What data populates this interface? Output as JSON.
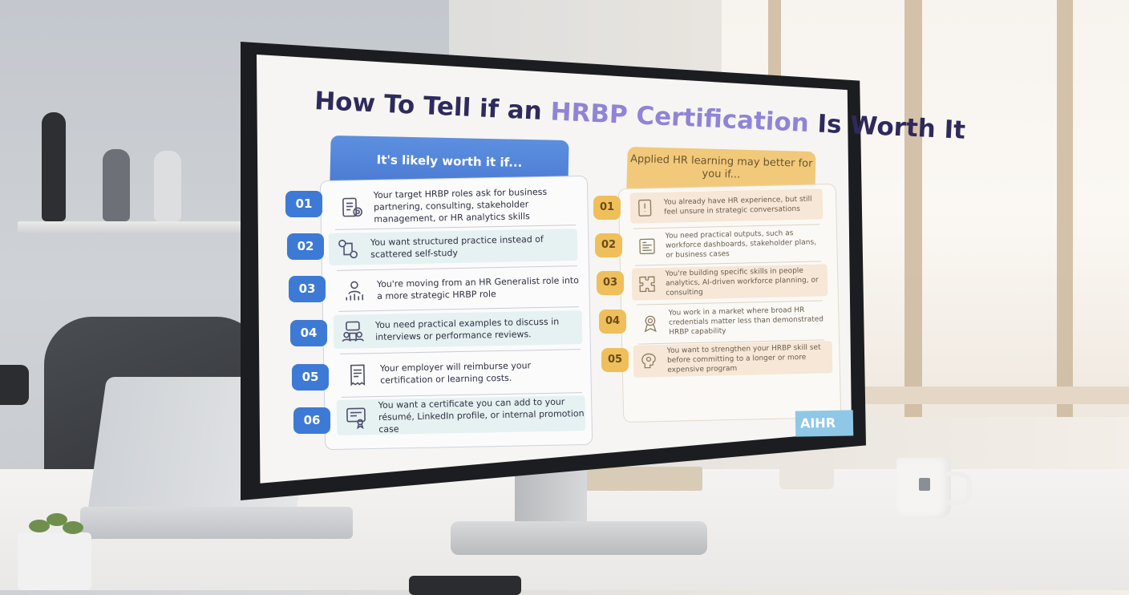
{
  "slide": {
    "title_pre": "How To Tell if an ",
    "title_highlight": "HRBP Certification",
    "title_post": " Is Worth It",
    "left_header": "It's likely worth it if...",
    "right_header": "Applied HR learning may better for you if...",
    "left_items": [
      {
        "num": "01",
        "icon": "clipboard-target-icon",
        "text": "Your target HRBP roles ask for business partnering, consulting, stakeholder management, or HR analytics skills"
      },
      {
        "num": "02",
        "icon": "connected-people-icon",
        "text": "You want structured practice instead of scattered self-study"
      },
      {
        "num": "03",
        "icon": "career-growth-icon",
        "text": "You're moving from an HR Generalist role into a more strategic HRBP role"
      },
      {
        "num": "04",
        "icon": "discussion-icon",
        "text": "You need practical examples to discuss in interviews or performance reviews."
      },
      {
        "num": "05",
        "icon": "receipt-icon",
        "text": "Your employer will reimburse your certification or learning costs."
      },
      {
        "num": "06",
        "icon": "certificate-icon",
        "text": "You want a certificate you can add to your résumé, LinkedIn profile, or internal promotion case"
      }
    ],
    "right_items": [
      {
        "num": "01",
        "icon": "document-alert-icon",
        "text": "You already have HR experience, but still feel unsure in strategic conversations"
      },
      {
        "num": "02",
        "icon": "dashboard-icon",
        "text": "You need practical outputs, such as workforce dashboards, stakeholder plans, or business cases"
      },
      {
        "num": "03",
        "icon": "puzzle-icon",
        "text": "You're building specific skills in people analytics, AI-driven workforce planning, or consulting"
      },
      {
        "num": "04",
        "icon": "award-ribbon-icon",
        "text": "You work in a market where broad HR credentials matter less than demonstrated HRBP capability"
      },
      {
        "num": "05",
        "icon": "brain-gear-icon",
        "text": "You want to strengthen your HRBP skill set before committing to a longer or more expensive program"
      }
    ],
    "brand": "AIHR"
  },
  "colors": {
    "blue": "#3d7ad6",
    "gold": "#efbf5c",
    "title": "#2e2a5c",
    "highlight": "#8f84d6"
  }
}
